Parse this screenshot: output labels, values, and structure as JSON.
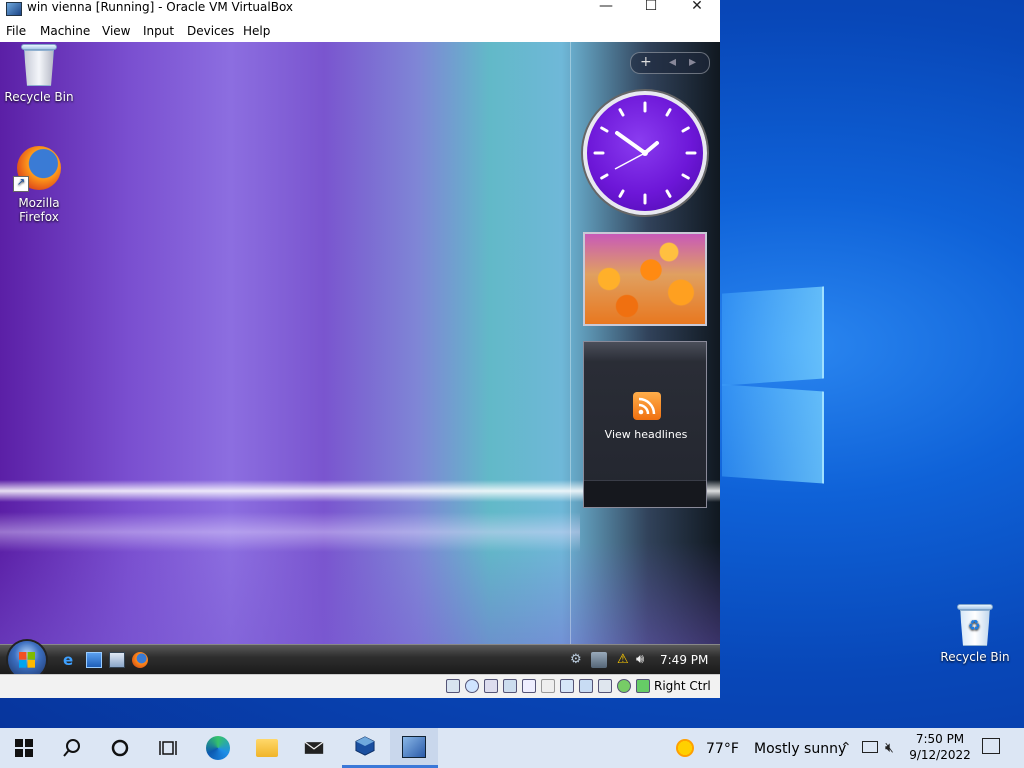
{
  "host_desktop": {
    "recycle_bin_label": "Recycle Bin"
  },
  "vm_window": {
    "title": "win vienna [Running] - Oracle VM VirtualBox",
    "controls": {
      "minimize": "—",
      "maximize": "☐",
      "close": "✕"
    },
    "menu": [
      "File",
      "Machine",
      "View",
      "Input",
      "Devices",
      "Help"
    ],
    "guest": {
      "desktop_icons": [
        {
          "label": "Recycle Bin",
          "icon": "recycle-bin-icon"
        },
        {
          "label": "Mozilla Firefox",
          "icon": "firefox-icon"
        }
      ],
      "gadget_controls": {
        "add": "+",
        "prev": "◂",
        "next": "▸"
      },
      "feed_gadget": {
        "label": "View headlines"
      },
      "taskbar": {
        "quick_launch": [
          "internet-explorer-icon",
          "show-desktop-icon",
          "switch-windows-icon",
          "firefox-icon"
        ],
        "tray_icons": [
          "network-icon",
          "monitor-icon",
          "security-warning-icon",
          "volume-icon"
        ],
        "clock": "7:49 PM"
      }
    },
    "statusbar": {
      "icons": [
        "hard-disk-icon",
        "optical-drive-icon",
        "audio-icon",
        "network-icon",
        "usb-icon",
        "shared-folder-icon",
        "display-icon",
        "video-capture-icon",
        "cpu-icon",
        "mouse-integration-icon",
        "keyboard-icon"
      ],
      "host_key": "Right Ctrl"
    }
  },
  "taskbar": {
    "items": [
      "start-button",
      "search-icon",
      "cortana-icon",
      "task-view-icon",
      "edge-icon",
      "file-explorer-icon",
      "mail-icon",
      "virtualbox-icon",
      "vista-vm-icon"
    ],
    "weather": {
      "temp": "77°F",
      "condition": "Mostly sunny"
    },
    "clock": {
      "time": "7:50 PM",
      "date": "9/12/2022"
    }
  },
  "colors": {
    "host_desktop": "#0a4fc8",
    "host_taskbar": "#dce6f4",
    "guest_clock_face": "#6d17d8",
    "rss_orange": "#f07010"
  }
}
